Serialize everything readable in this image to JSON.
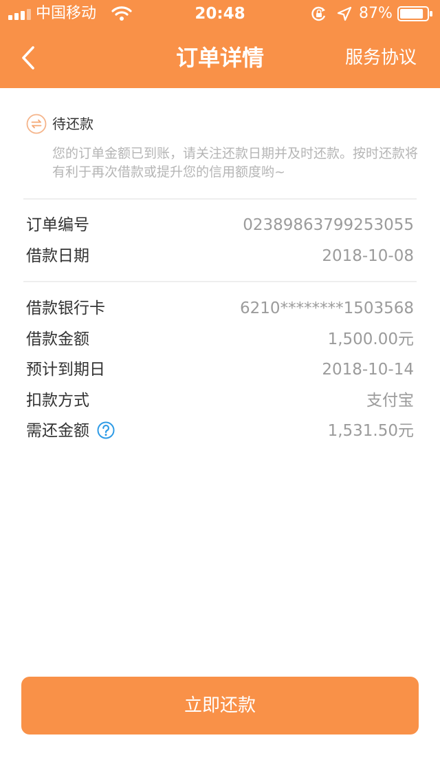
{
  "status_bar": {
    "carrier": "中国移动",
    "time": "20:48",
    "battery_percent": "87%",
    "signal_icon": "cellular-signal-icon",
    "wifi_icon": "wifi-icon",
    "lock_icon": "orientation-lock-icon",
    "location_icon": "location-arrow-icon",
    "battery_icon": "battery-icon",
    "battery_level": 0.87
  },
  "nav": {
    "back_icon": "chevron-left-icon",
    "title": "订单详情",
    "right_action": "服务协议"
  },
  "order_status": {
    "icon": "repay-arrows-icon",
    "label": "待还款",
    "description": "您的订单金额已到账，请关注还款日期并及时还款。按时还款将有利于再次借款或提升您的信用额度哟~"
  },
  "order_info": [
    {
      "label": "订单编号",
      "value": "02389863799253055"
    },
    {
      "label": "借款日期",
      "value": "2018-10-08"
    }
  ],
  "loan_info": [
    {
      "label": "借款银行卡",
      "value": "6210********1503568"
    },
    {
      "label": "借款金额",
      "value": "1,500.00元"
    },
    {
      "label": "预计到期日",
      "value": "2018-10-14"
    },
    {
      "label": "扣款方式",
      "value": "支付宝"
    },
    {
      "label": "需还金额",
      "value": "1,531.50元",
      "icon": "help-question-icon"
    }
  ],
  "actions": {
    "repay_now": "立即还款"
  },
  "colors": {
    "brand_orange": "#f99148",
    "help_blue": "#2e9be6",
    "muted_text": "#9b9b9b"
  }
}
